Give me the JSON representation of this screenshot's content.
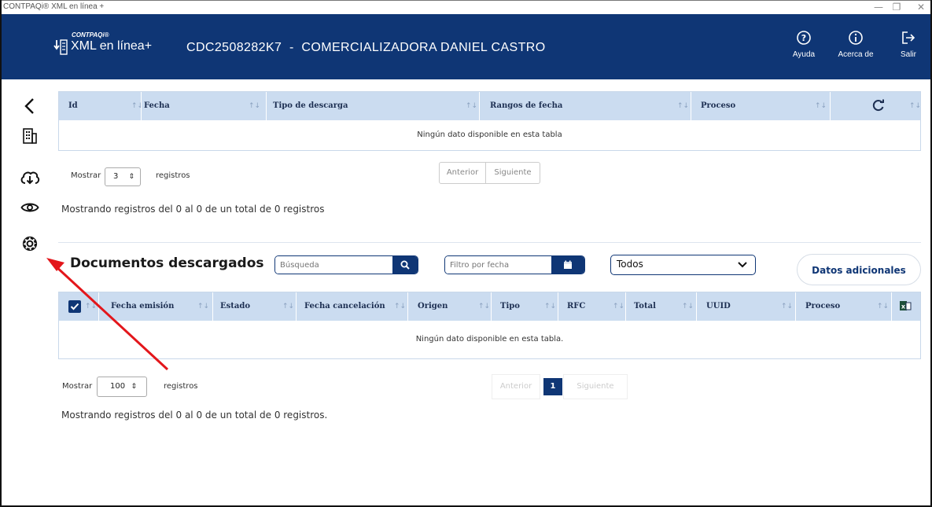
{
  "window": {
    "title": "CONTPAQi® XML en línea +",
    "controls": [
      "—",
      "❐",
      "✕"
    ]
  },
  "header": {
    "brand_small": "CONTPAQi®",
    "brand": "XML en línea+",
    "company": "CDC2508282K7  -  COMERCIALIZADORA DANIEL CASTRO",
    "buttons": [
      {
        "label": "Ayuda",
        "icon": "help-icon"
      },
      {
        "label": "Acerca de",
        "icon": "info-icon"
      },
      {
        "label": "Salir",
        "icon": "logout-icon"
      }
    ]
  },
  "sidebar": {
    "items": [
      {
        "name": "back-icon"
      },
      {
        "name": "building-icon"
      },
      {
        "name": "cloud-download-icon"
      },
      {
        "name": "eye-icon"
      },
      {
        "name": "settings-icon"
      }
    ]
  },
  "downloads_table": {
    "columns": [
      "Id",
      "Fecha",
      "Tipo de descarga",
      "Rangos de fecha",
      "Proceso"
    ],
    "empty_message": "Ningún dato disponible en esta tabla",
    "show_label": "Mostrar",
    "show_value": "3",
    "records_label": "registros",
    "prev": "Anterior",
    "next": "Siguiente",
    "info": "Mostrando registros del 0 al 0 de un total de 0 registros"
  },
  "documents": {
    "title": "Documentos descargados",
    "search_placeholder": "Búsqueda",
    "date_filter_placeholder": "Filtro por fecha",
    "type_filter_value": "Todos",
    "additional_button": "Datos adicionales",
    "columns": [
      "Fecha emisión",
      "Estado",
      "Fecha cancelación",
      "Origen",
      "Tipo",
      "RFC",
      "Total",
      "UUID",
      "Proceso"
    ],
    "empty_message": "Ningún dato disponible en esta tabla.",
    "show_label": "Mostrar",
    "show_value": "100",
    "records_label": "registros",
    "prev": "Anterior",
    "page": "1",
    "next": "Siguiente",
    "info": "Mostrando registros del 0 al 0 de un total de 0 registros."
  },
  "colors": {
    "header_bg": "#0f3675",
    "table_header_bg": "#cbdcf0",
    "annotation_arrow": "#e3161b"
  }
}
